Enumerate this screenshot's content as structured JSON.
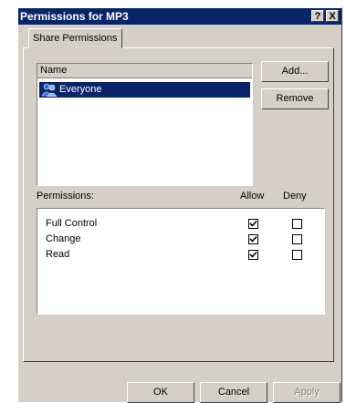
{
  "window": {
    "title": "Permissions for MP3"
  },
  "titlebar": {
    "help_label": "?",
    "close_label": "X"
  },
  "tabs": [
    {
      "label": "Share Permissions"
    }
  ],
  "users": {
    "header": "Name",
    "items": [
      {
        "label": "Everyone",
        "icon": "users-group-icon",
        "selected": true
      }
    ],
    "add_label": "Add...",
    "remove_label": "Remove"
  },
  "permissions": {
    "label": "Permissions:",
    "allow_label": "Allow",
    "deny_label": "Deny",
    "rows": [
      {
        "label": "Full Control",
        "allow": true,
        "deny": false
      },
      {
        "label": "Change",
        "allow": true,
        "deny": false
      },
      {
        "label": "Read",
        "allow": true,
        "deny": false
      }
    ]
  },
  "footer": {
    "ok_label": "OK",
    "cancel_label": "Cancel",
    "apply_label": "Apply"
  },
  "colors": {
    "face": "#d4d0c8",
    "selection": "#0a246a",
    "title_bar": "#0a246a"
  }
}
